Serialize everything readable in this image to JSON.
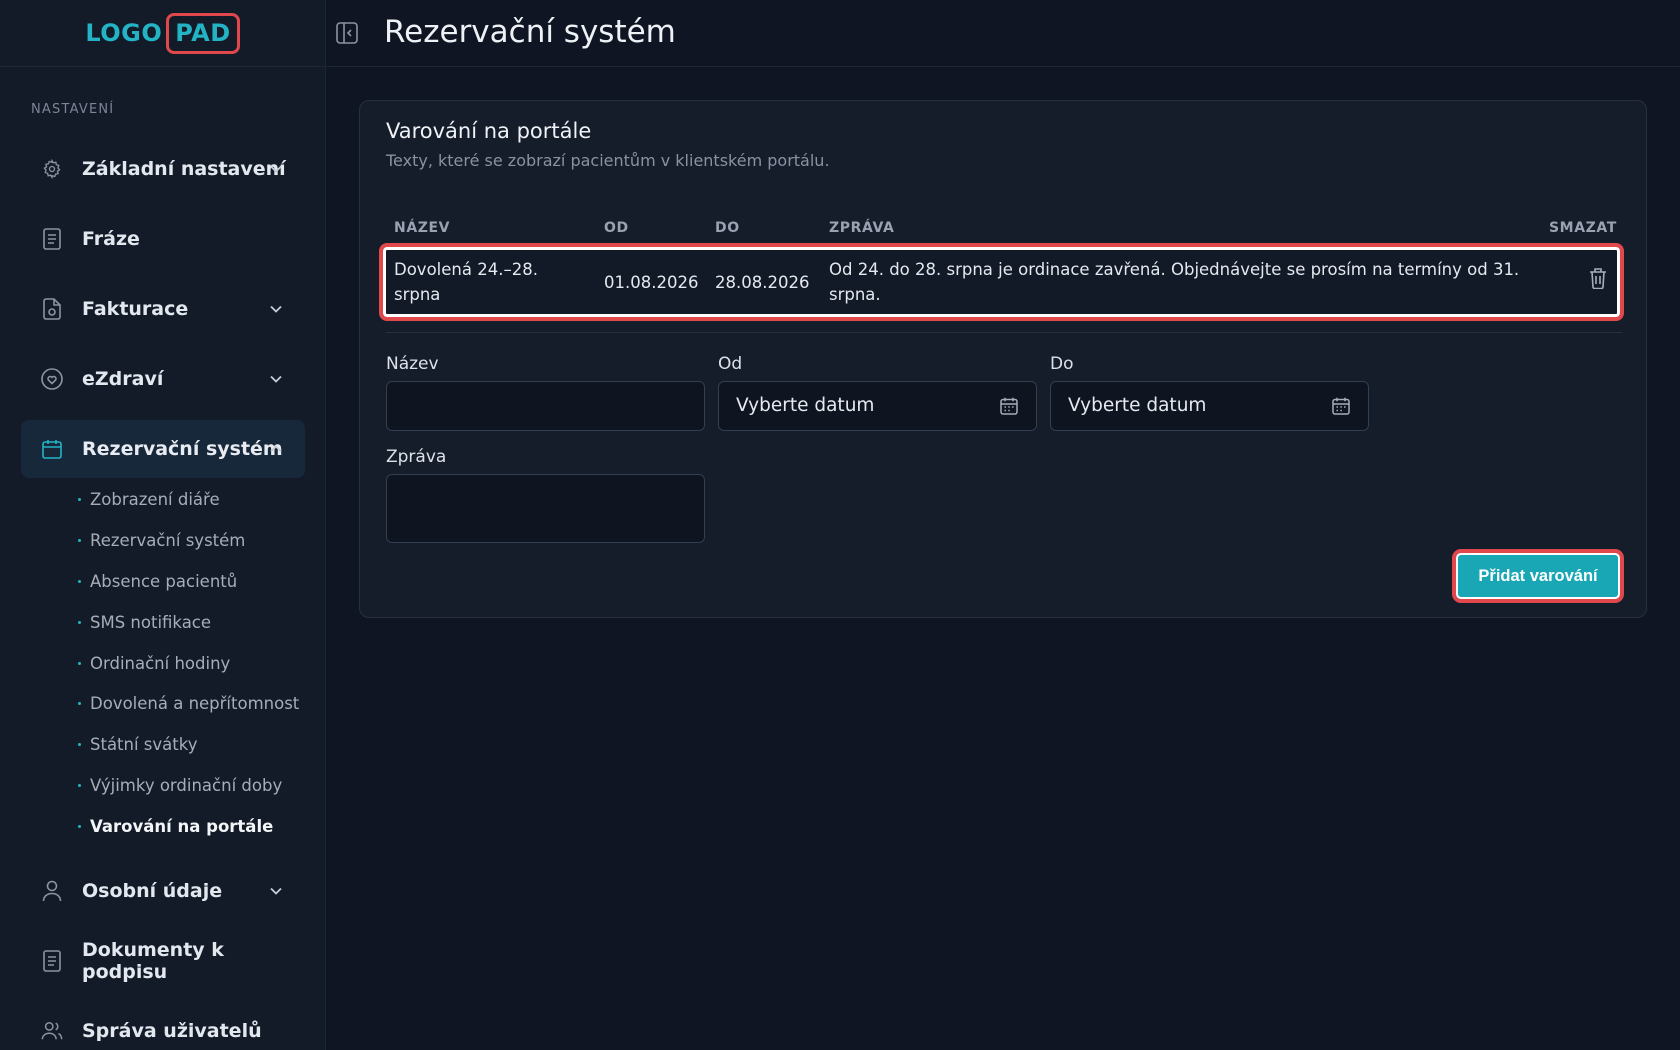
{
  "logo": {
    "left": "LOGO",
    "right": "PAD"
  },
  "header": {
    "title": "Rezervační systém"
  },
  "sidebar": {
    "section_label": "NASTAVENÍ",
    "items": [
      {
        "label": "Základní nastavení",
        "icon": "gear-icon"
      },
      {
        "label": "Fráze",
        "icon": "document-icon"
      },
      {
        "label": "Fakturace",
        "icon": "invoice-icon"
      },
      {
        "label": "eZdraví",
        "icon": "heart-icon"
      },
      {
        "label": "Rezervační systém",
        "icon": "calendar-icon"
      },
      {
        "label": "Osobní údaje",
        "icon": "user-icon"
      },
      {
        "label": "Dokumenty k podpisu",
        "icon": "document-icon"
      },
      {
        "label": "Správa uživatelů",
        "icon": "users-icon"
      }
    ],
    "subitems": [
      "Zobrazení diáře",
      "Rezervační systém",
      "Absence pacientů",
      "SMS notifikace",
      "Ordinační hodiny",
      "Dovolená a nepřítomnost",
      "Státní svátky",
      "Výjimky ordinační doby",
      "Varování na portále"
    ]
  },
  "card": {
    "title": "Varování na portále",
    "subtitle": "Texty, které se zobrazí pacientům v klientském portálu.",
    "columns": {
      "name": "NÁZEV",
      "from": "OD",
      "to": "DO",
      "message": "ZPRÁVA",
      "delete": "SMAZAT"
    },
    "rows": [
      {
        "name_line1": "Dovolená 24.–28.",
        "name_line2": "srpna",
        "from": "01.08.2026",
        "to": "28.08.2026",
        "message_line1": "Od 24. do 28. srpna je ordinace zavřená. Objednávejte se prosím na termíny od 31.",
        "message_line2": "srpna."
      }
    ],
    "form": {
      "name_label": "Název",
      "name_value": "",
      "from_label": "Od",
      "from_placeholder": "Vyberte datum",
      "to_label": "Do",
      "to_placeholder": "Vyberte datum",
      "message_label": "Zpráva",
      "message_value": "",
      "submit_label": "Přidat varování"
    }
  },
  "colors": {
    "accent": "#23b3c4",
    "highlight": "#e0484c",
    "button": "#1aa7b5"
  }
}
